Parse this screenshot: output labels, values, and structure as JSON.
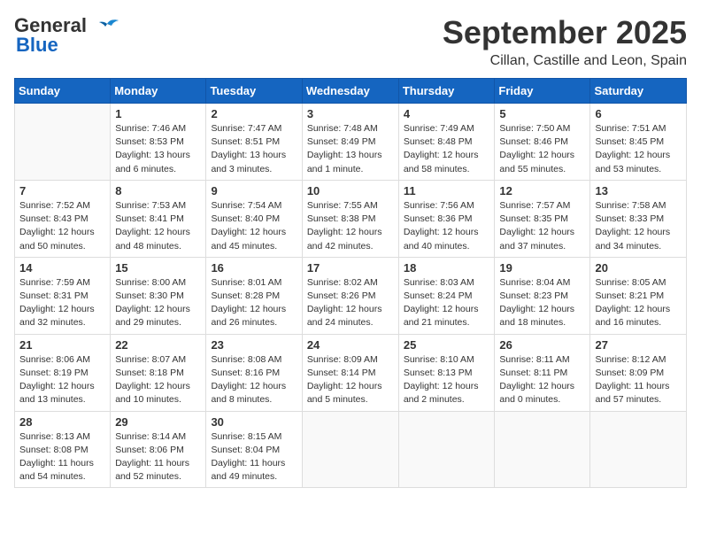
{
  "header": {
    "logo_line1": "General",
    "logo_line2": "Blue",
    "month": "September 2025",
    "location": "Cillan, Castille and Leon, Spain"
  },
  "weekdays": [
    "Sunday",
    "Monday",
    "Tuesday",
    "Wednesday",
    "Thursday",
    "Friday",
    "Saturday"
  ],
  "weeks": [
    [
      {
        "day": "",
        "info": ""
      },
      {
        "day": "1",
        "info": "Sunrise: 7:46 AM\nSunset: 8:53 PM\nDaylight: 13 hours\nand 6 minutes."
      },
      {
        "day": "2",
        "info": "Sunrise: 7:47 AM\nSunset: 8:51 PM\nDaylight: 13 hours\nand 3 minutes."
      },
      {
        "day": "3",
        "info": "Sunrise: 7:48 AM\nSunset: 8:49 PM\nDaylight: 13 hours\nand 1 minute."
      },
      {
        "day": "4",
        "info": "Sunrise: 7:49 AM\nSunset: 8:48 PM\nDaylight: 12 hours\nand 58 minutes."
      },
      {
        "day": "5",
        "info": "Sunrise: 7:50 AM\nSunset: 8:46 PM\nDaylight: 12 hours\nand 55 minutes."
      },
      {
        "day": "6",
        "info": "Sunrise: 7:51 AM\nSunset: 8:45 PM\nDaylight: 12 hours\nand 53 minutes."
      }
    ],
    [
      {
        "day": "7",
        "info": "Sunrise: 7:52 AM\nSunset: 8:43 PM\nDaylight: 12 hours\nand 50 minutes."
      },
      {
        "day": "8",
        "info": "Sunrise: 7:53 AM\nSunset: 8:41 PM\nDaylight: 12 hours\nand 48 minutes."
      },
      {
        "day": "9",
        "info": "Sunrise: 7:54 AM\nSunset: 8:40 PM\nDaylight: 12 hours\nand 45 minutes."
      },
      {
        "day": "10",
        "info": "Sunrise: 7:55 AM\nSunset: 8:38 PM\nDaylight: 12 hours\nand 42 minutes."
      },
      {
        "day": "11",
        "info": "Sunrise: 7:56 AM\nSunset: 8:36 PM\nDaylight: 12 hours\nand 40 minutes."
      },
      {
        "day": "12",
        "info": "Sunrise: 7:57 AM\nSunset: 8:35 PM\nDaylight: 12 hours\nand 37 minutes."
      },
      {
        "day": "13",
        "info": "Sunrise: 7:58 AM\nSunset: 8:33 PM\nDaylight: 12 hours\nand 34 minutes."
      }
    ],
    [
      {
        "day": "14",
        "info": "Sunrise: 7:59 AM\nSunset: 8:31 PM\nDaylight: 12 hours\nand 32 minutes."
      },
      {
        "day": "15",
        "info": "Sunrise: 8:00 AM\nSunset: 8:30 PM\nDaylight: 12 hours\nand 29 minutes."
      },
      {
        "day": "16",
        "info": "Sunrise: 8:01 AM\nSunset: 8:28 PM\nDaylight: 12 hours\nand 26 minutes."
      },
      {
        "day": "17",
        "info": "Sunrise: 8:02 AM\nSunset: 8:26 PM\nDaylight: 12 hours\nand 24 minutes."
      },
      {
        "day": "18",
        "info": "Sunrise: 8:03 AM\nSunset: 8:24 PM\nDaylight: 12 hours\nand 21 minutes."
      },
      {
        "day": "19",
        "info": "Sunrise: 8:04 AM\nSunset: 8:23 PM\nDaylight: 12 hours\nand 18 minutes."
      },
      {
        "day": "20",
        "info": "Sunrise: 8:05 AM\nSunset: 8:21 PM\nDaylight: 12 hours\nand 16 minutes."
      }
    ],
    [
      {
        "day": "21",
        "info": "Sunrise: 8:06 AM\nSunset: 8:19 PM\nDaylight: 12 hours\nand 13 minutes."
      },
      {
        "day": "22",
        "info": "Sunrise: 8:07 AM\nSunset: 8:18 PM\nDaylight: 12 hours\nand 10 minutes."
      },
      {
        "day": "23",
        "info": "Sunrise: 8:08 AM\nSunset: 8:16 PM\nDaylight: 12 hours\nand 8 minutes."
      },
      {
        "day": "24",
        "info": "Sunrise: 8:09 AM\nSunset: 8:14 PM\nDaylight: 12 hours\nand 5 minutes."
      },
      {
        "day": "25",
        "info": "Sunrise: 8:10 AM\nSunset: 8:13 PM\nDaylight: 12 hours\nand 2 minutes."
      },
      {
        "day": "26",
        "info": "Sunrise: 8:11 AM\nSunset: 8:11 PM\nDaylight: 12 hours\nand 0 minutes."
      },
      {
        "day": "27",
        "info": "Sunrise: 8:12 AM\nSunset: 8:09 PM\nDaylight: 11 hours\nand 57 minutes."
      }
    ],
    [
      {
        "day": "28",
        "info": "Sunrise: 8:13 AM\nSunset: 8:08 PM\nDaylight: 11 hours\nand 54 minutes."
      },
      {
        "day": "29",
        "info": "Sunrise: 8:14 AM\nSunset: 8:06 PM\nDaylight: 11 hours\nand 52 minutes."
      },
      {
        "day": "30",
        "info": "Sunrise: 8:15 AM\nSunset: 8:04 PM\nDaylight: 11 hours\nand 49 minutes."
      },
      {
        "day": "",
        "info": ""
      },
      {
        "day": "",
        "info": ""
      },
      {
        "day": "",
        "info": ""
      },
      {
        "day": "",
        "info": ""
      }
    ]
  ]
}
